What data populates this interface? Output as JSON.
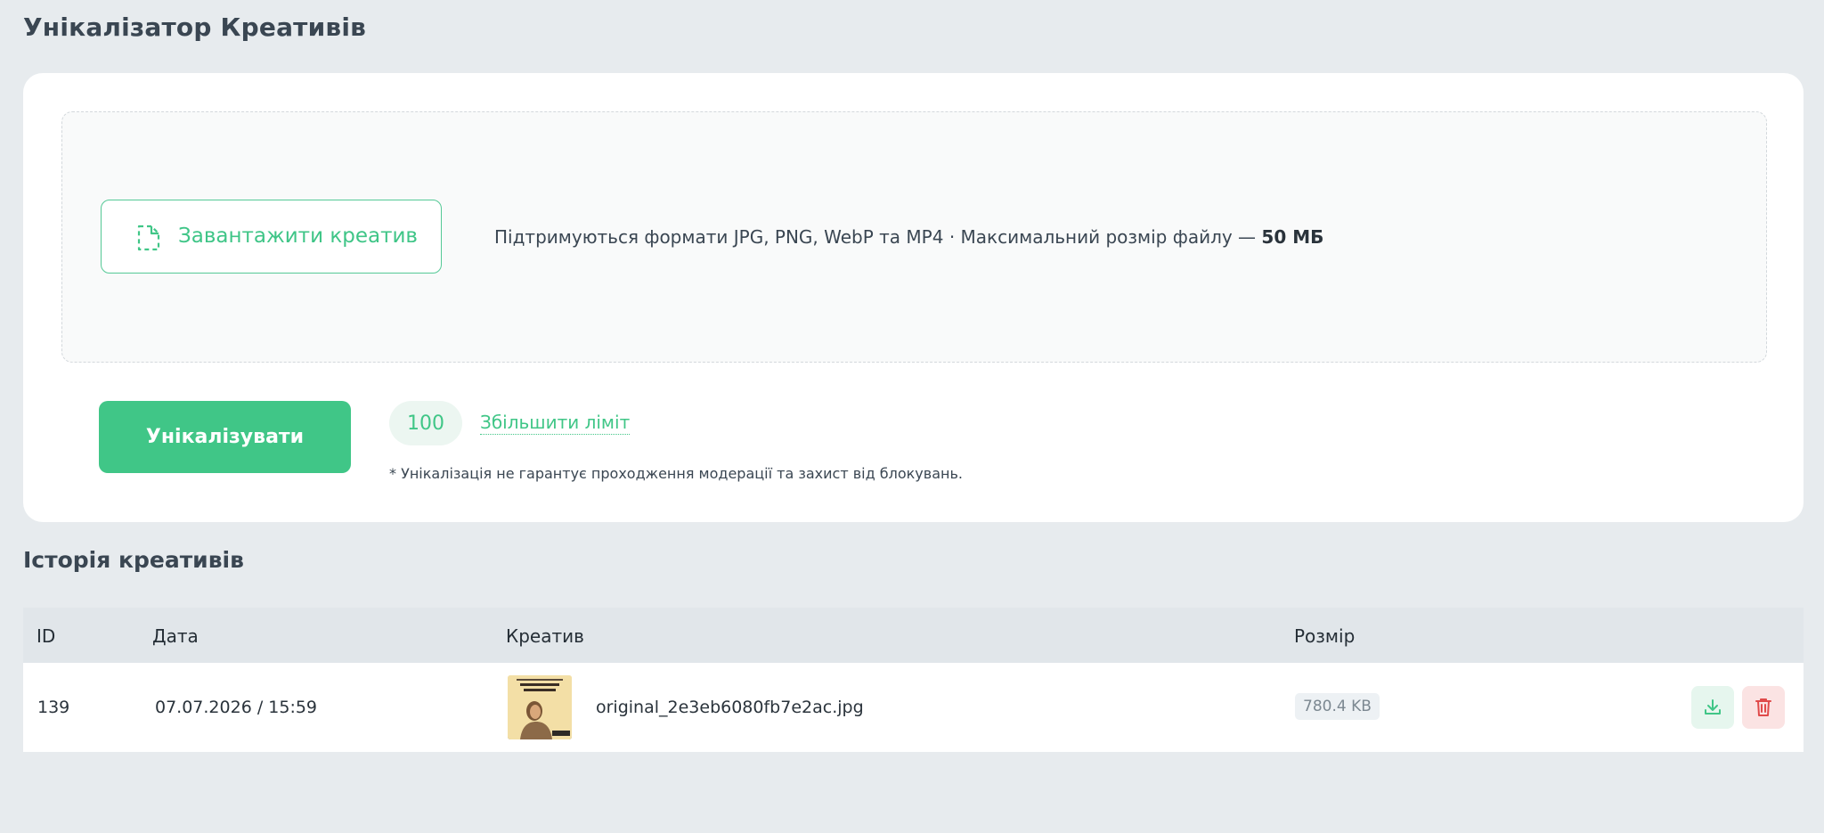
{
  "page": {
    "title": "Унікалізатор Креативів"
  },
  "upload": {
    "button_label": "Завантажити креатив",
    "icon": "file-dashed-icon",
    "formats_text": "Підтримуються формати JPG, PNG, WebP та MP4 · Максимальний розмір файлу — ",
    "max_size": "50 МБ"
  },
  "actions": {
    "unique_button_label": "Унікалізувати",
    "limit_count": "100",
    "increase_limit_label": "Збільшити ліміт",
    "disclaimer": "* Унікалізація не гарантує проходження модерації та захист від блокувань."
  },
  "history": {
    "title": "Історія креативів",
    "columns": [
      "ID",
      "Дата",
      "Креатив",
      "Розмір"
    ],
    "rows": [
      {
        "id": "139",
        "date": "07.07.2026 / 15:59",
        "filename": "original_2e3eb6080fb7e2ac.jpg",
        "size": "780.4 KB"
      }
    ]
  },
  "colors": {
    "accent": "#40c687",
    "background": "#e7ebee",
    "danger": "#e04a4a"
  },
  "icons": {
    "download": "download-icon",
    "delete": "trash-icon"
  }
}
